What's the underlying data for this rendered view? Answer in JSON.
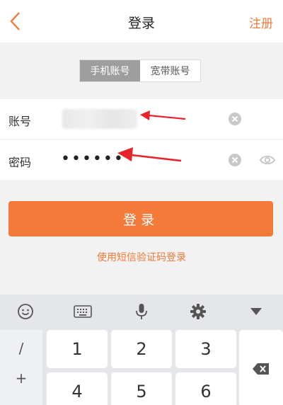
{
  "header": {
    "title": "登录",
    "register_label": "注册"
  },
  "tabs": [
    {
      "label": "手机账号",
      "active": true
    },
    {
      "label": "宽带账号",
      "active": false
    }
  ],
  "form": {
    "account_label": "账号",
    "password_label": "密码",
    "password_value": "••••••"
  },
  "login_button_label": "登录",
  "sms_login_link": "使用短信验证码登录",
  "keyboard": {
    "symbols": [
      "/",
      "+"
    ],
    "keys": [
      "1",
      "2",
      "3",
      "4",
      "5",
      "6"
    ]
  },
  "colors": {
    "accent": "#f47a3a",
    "arrow": "#e8242a",
    "tab_active_bg": "#9e9e9e"
  }
}
